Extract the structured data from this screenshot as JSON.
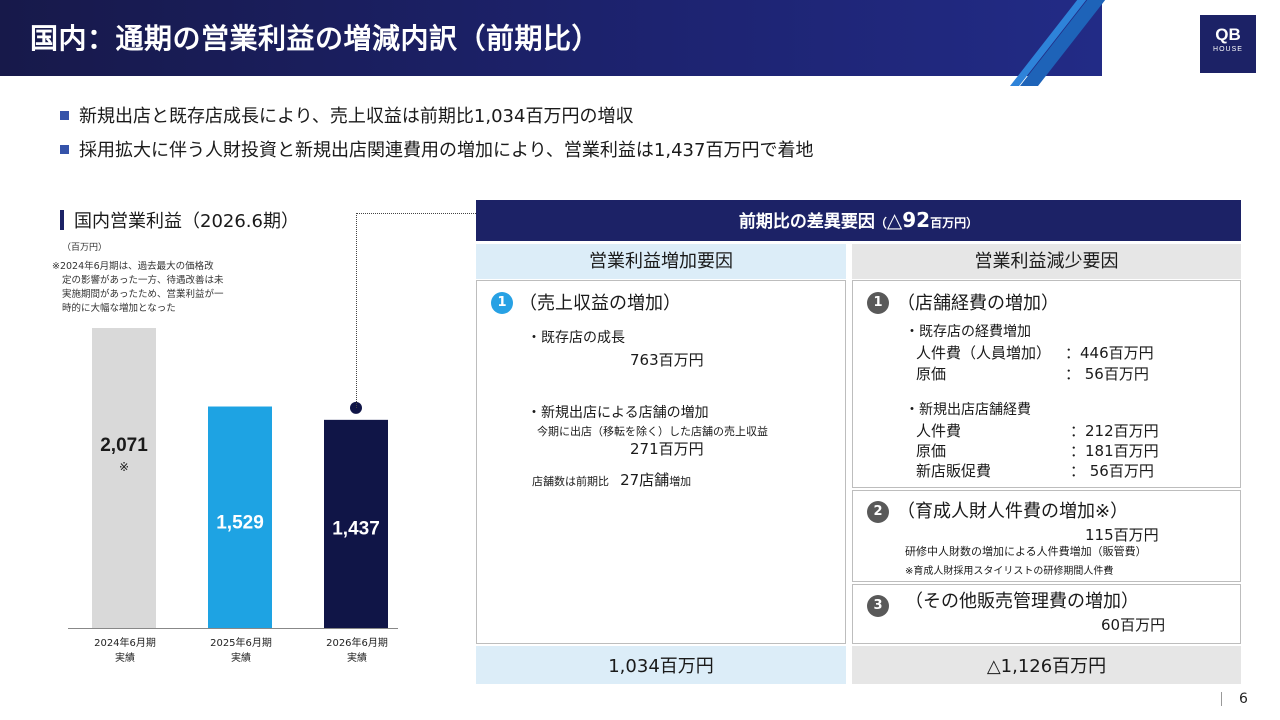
{
  "header": {
    "title": "国内：通期の営業利益の増減内訳（前期比）",
    "logo_main": "QB",
    "logo_sub": "HOUSE"
  },
  "bullets": [
    "新規出店と既存店成長により、売上収益は前期比1,034百万円の増収",
    "採用拡大に伴う人財投資と新規出店関連費用の増加により、営業利益は1,437百万円で着地"
  ],
  "chart_data": {
    "type": "bar",
    "title": "国内営業利益（2026.6期）",
    "unit": "（百万円）",
    "note_lines": [
      "※2024年6月期は、過去最大の価格改",
      "定の影響があった一方、待遇改善は未",
      "実施期間があったため、営業利益が一",
      "時的に大幅な増加となった"
    ],
    "categories": [
      [
        "2024年6月期",
        "実績"
      ],
      [
        "2025年6月期",
        "実績"
      ],
      [
        "2026年6月期",
        "実績"
      ]
    ],
    "values": [
      2071,
      1529,
      1437
    ],
    "value_labels": [
      "2,071",
      "1,529",
      "1,437"
    ],
    "value_sublabels": [
      "※",
      "",
      ""
    ],
    "colors": [
      "#d9d9d9",
      "#1ea3e3",
      "#101547"
    ],
    "label_colors": [
      "#1a1a1a",
      "#ffffff",
      "#ffffff"
    ],
    "ylim": [
      0,
      2071
    ]
  },
  "panel": {
    "title_main": "前期比の差異要因",
    "title_small_open": "（",
    "title_value": "△92",
    "title_unit": "百万円",
    "title_small_close": "）",
    "increase": {
      "header": "営業利益増加要因",
      "badge": "1",
      "title": "（売上収益の増加）",
      "item1_label": "・既存店の成長",
      "item1_value": "763百万円",
      "item2_label": "・新規出店による店舗の増加",
      "item2_note": "今期に出店（移転を除く）した店舗の売上収益",
      "item2_value": "271百万円",
      "store_prefix": "店舗数は前期比",
      "store_value": "27店舗",
      "store_suffix": "増加",
      "total": "1,034百万円"
    },
    "decrease": {
      "header": "営業利益減少要因",
      "badge1": "1",
      "title1": "（店舗経費の増加）",
      "g1_label": "・既存店の経費増加",
      "g1_r1_label": "人件費（人員増加）",
      "g1_r1_value": "：446百万円",
      "g1_r2_label": "原価",
      "g1_r2_value": "：  56百万円",
      "g2_label": "・新規出店店舗経費",
      "g2_r1_label": "人件費",
      "g2_r1_value": "：212百万円",
      "g2_r2_label": "原価",
      "g2_r2_value": "：181百万円",
      "g2_r3_label": "新店販促費",
      "g2_r3_value": "：  56百万円",
      "badge2": "2",
      "title2": "（育成人財人件費の増加※）",
      "v2": "115百万円",
      "desc2": "研修中人財数の増加による人件費増加（販管費）",
      "note2": "※育成人財採用スタイリストの研修期間人件費",
      "badge3": "3",
      "title3": "（その他販売管理費の増加）",
      "v3": "60百万円",
      "total": "△1,126百万円"
    }
  },
  "page_number": "6"
}
